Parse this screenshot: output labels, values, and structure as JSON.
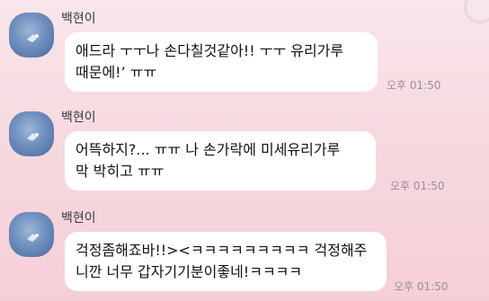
{
  "messages": [
    {
      "sender": "백현이",
      "lines": [
        "애드라 ㅜㅜ나 손다칠것같아!! ㅜㅜ 유리가루",
        "때문에!’ ㅠㅠ"
      ],
      "time": "오후 01:50"
    },
    {
      "sender": "백현이",
      "lines": [
        "어뜩하지?... ㅠㅠ 나 손가락에 미세유리가루",
        "막 박히고 ㅠㅠ"
      ],
      "time": "오후 01:50"
    },
    {
      "sender": "백현이",
      "lines": [
        "걱정좀해죠바!!><ㅋㅋㅋㅋㅋㅋㅋㅋㅋ 걱정해주",
        "니깐 너무 갑자기기분이좋네!ㅋㅋㅋㅋ"
      ],
      "time": "오후 01:50"
    }
  ]
}
